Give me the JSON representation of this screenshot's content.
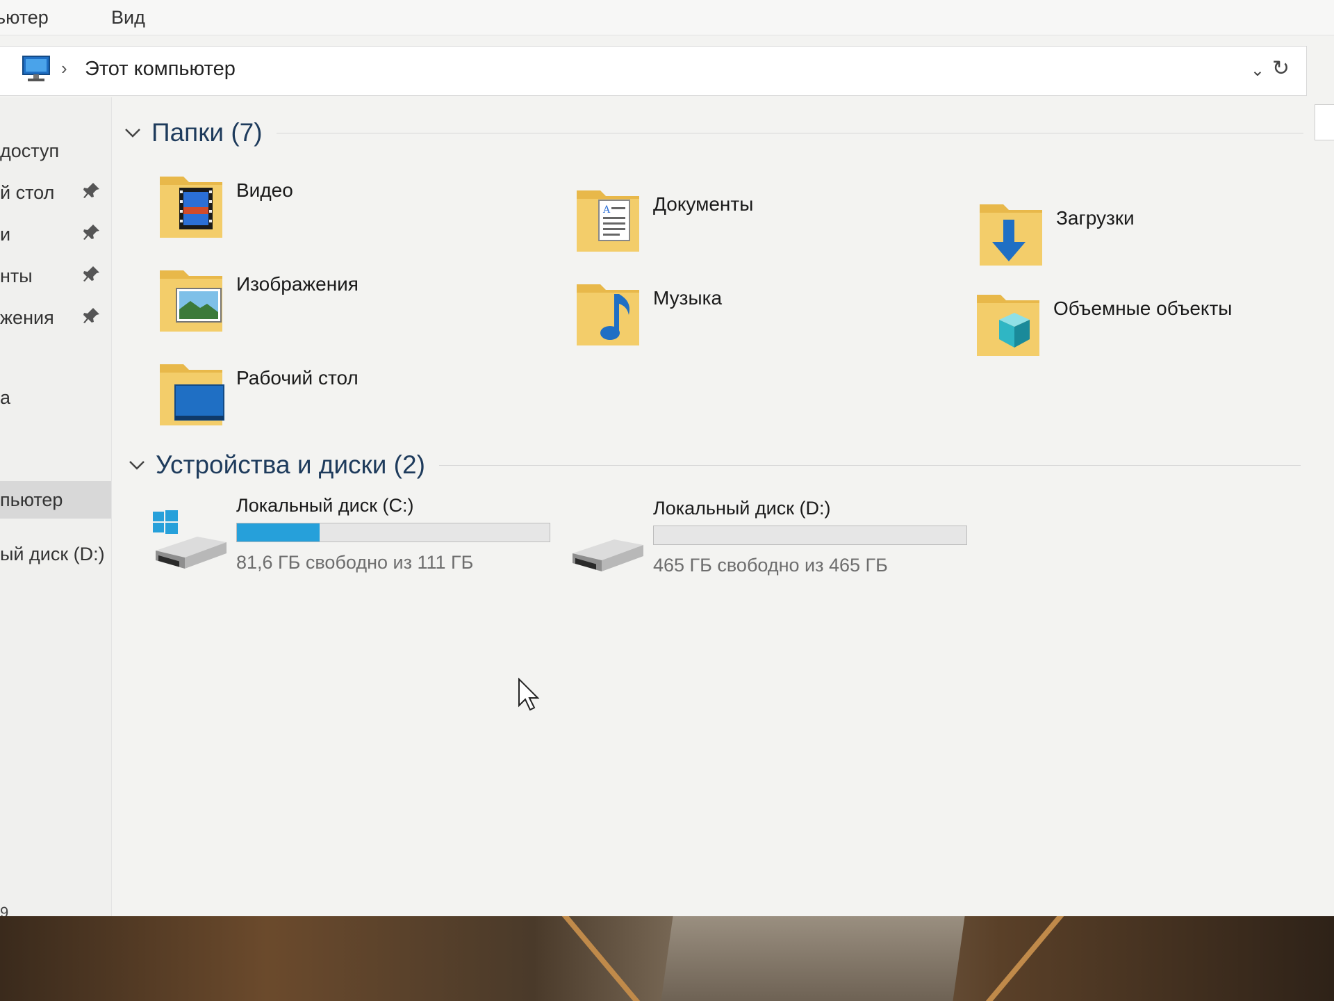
{
  "menu": {
    "computer": "ьютер",
    "view": "Вид"
  },
  "address": {
    "crumb": "Этот компьютер",
    "separator": "›"
  },
  "nav": {
    "items": [
      {
        "label": "доступ"
      },
      {
        "label": "й стол"
      },
      {
        "label": "и"
      },
      {
        "label": "нты"
      },
      {
        "label": "жения"
      },
      {
        "label": "а"
      },
      {
        "label": "пьютер"
      },
      {
        "label": "ый диск (D:)"
      }
    ]
  },
  "folders": {
    "header": "Папки (7)",
    "items": [
      {
        "label": "Видео",
        "icon": "video-folder-icon"
      },
      {
        "label": "Документы",
        "icon": "documents-folder-icon"
      },
      {
        "label": "Загрузки",
        "icon": "downloads-folder-icon"
      },
      {
        "label": "Изображения",
        "icon": "pictures-folder-icon"
      },
      {
        "label": "Музыка",
        "icon": "music-folder-icon"
      },
      {
        "label": "Объемные объекты",
        "icon": "3d-objects-folder-icon"
      },
      {
        "label": "Рабочий стол",
        "icon": "desktop-folder-icon"
      }
    ]
  },
  "devices": {
    "header": "Устройства и диски (2)",
    "items": [
      {
        "label": "Локальный диск (C:)",
        "free": "81,6 ГБ свободно из 111 ГБ",
        "used_fraction": 0.265
      },
      {
        "label": "Локальный диск (D:)",
        "free": "465 ГБ свободно из 465 ГБ",
        "used_fraction": 0.0
      }
    ]
  },
  "status": {
    "fragment": "9"
  },
  "colors": {
    "accent": "#26a0da",
    "folder": "#e8b84a",
    "header_text": "#1e3b5c"
  }
}
